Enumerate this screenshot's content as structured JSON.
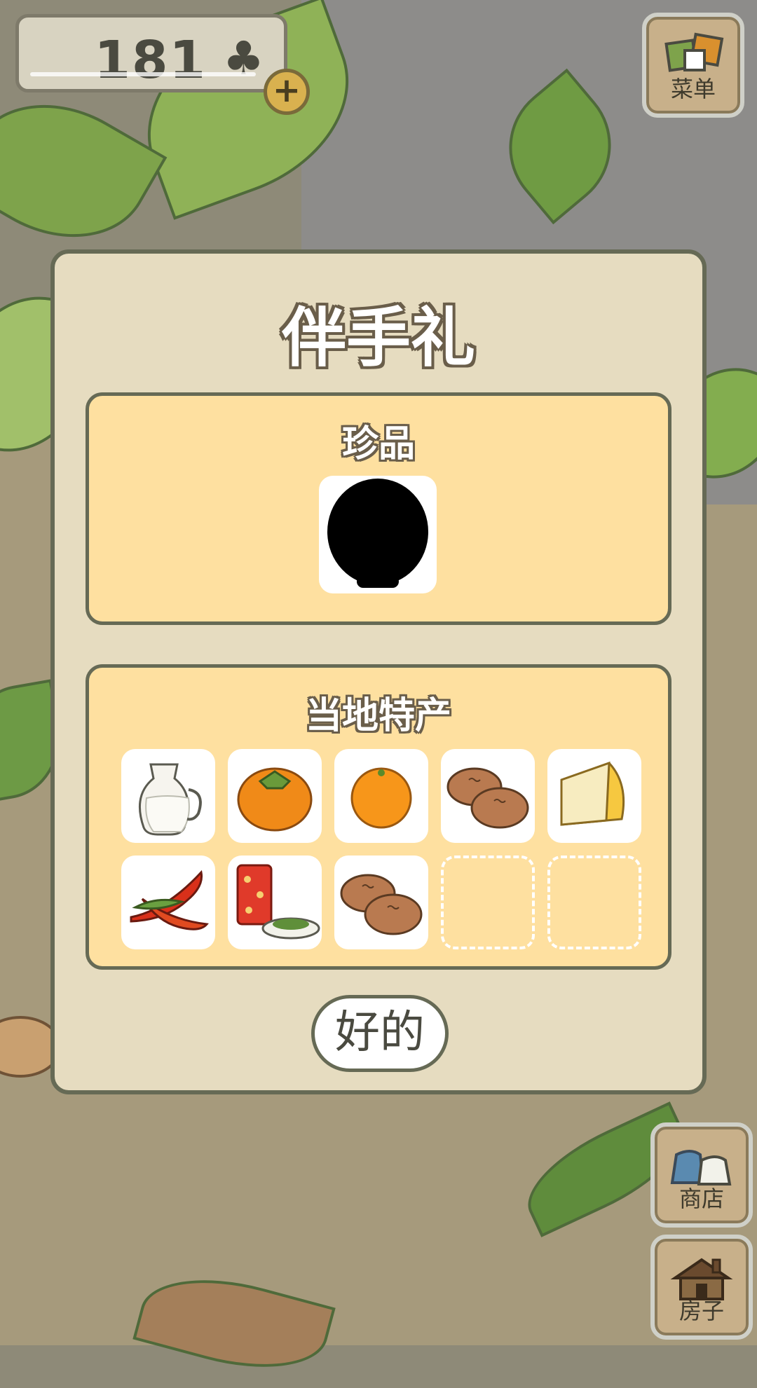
{
  "hud": {
    "currency_value": "181",
    "currency_icon": "clover-icon",
    "add_icon": "plus-icon"
  },
  "menu": {
    "label": "菜单",
    "icon": "menu-cards-icon"
  },
  "shop": {
    "label": "商店",
    "icon": "shop-bags-icon"
  },
  "house": {
    "label": "房子",
    "icon": "house-icon"
  },
  "dialog": {
    "title": "伴手礼",
    "rare_section": {
      "title": "珍品",
      "item_icon": "unknown-silhouette-icon"
    },
    "local_section": {
      "title": "当地特产",
      "items": [
        {
          "icon": "milk-jug-icon"
        },
        {
          "icon": "persimmon-icon"
        },
        {
          "icon": "orange-icon"
        },
        {
          "icon": "steamed-buns-icon"
        },
        {
          "icon": "cheese-icon"
        },
        {
          "icon": "chili-peppers-icon"
        },
        {
          "icon": "tea-can-icon"
        },
        {
          "icon": "steamed-buns-icon"
        },
        {
          "icon": "empty-slot"
        },
        {
          "icon": "empty-slot"
        }
      ]
    },
    "ok_label": "好的"
  },
  "colors": {
    "dialog_bg": "#e6dcc0",
    "panel_bg": "#fee0a0",
    "border": "#666a55",
    "slot_bg": "#ffffff"
  }
}
